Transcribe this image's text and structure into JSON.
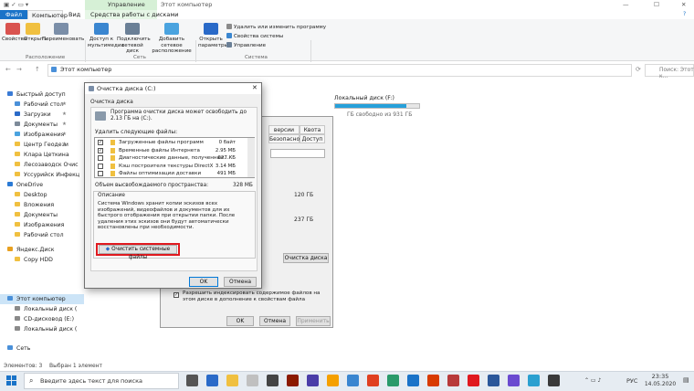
{
  "window": {
    "title": "Этот компьютер",
    "context_tab_title": "Управление",
    "minimize": "—",
    "maximize": "☐",
    "close": "✕"
  },
  "ribbon_tabs": {
    "file": "Файл",
    "computer": "Компьютер",
    "view": "Вид",
    "tools": "Средства работы с дисками"
  },
  "ribbon": {
    "properties": "Свойства",
    "open": "Открыть",
    "rename": "Переименовать",
    "media_access": "Доступ к мультимедиа",
    "map_drive": "Подключить сетевой диск",
    "add_location": "Добавить сетевое расположение",
    "open_settings": "Открыть параметры",
    "uninstall": "Удалить или изменить программу",
    "system_props": "Свойства системы",
    "manage": "Управление",
    "group_location": "Расположение",
    "group_network": "Сеть",
    "group_system": "Система"
  },
  "address": {
    "path": "Этот компьютер",
    "search_placeholder": "Поиск: Этот к...",
    "up_arrow": "↑",
    "back": "←",
    "forward": "→",
    "refresh": "⟳"
  },
  "nav": [
    {
      "label": "Быстрый доступ",
      "color": "#3a7bd5",
      "pin": ""
    },
    {
      "label": "Рабочий стол",
      "color": "#4a90d9",
      "pin": "★"
    },
    {
      "label": "Загрузки",
      "color": "#2a6ac8",
      "pin": "★"
    },
    {
      "label": "Документы",
      "color": "#7d8a99",
      "pin": "★"
    },
    {
      "label": "Изображения",
      "color": "#4aa3df",
      "pin": "★"
    },
    {
      "label": "Центр Геодези",
      "color": "#f0c040",
      "pin": "★"
    },
    {
      "label": "Клара Цеткина",
      "color": "#f0c040",
      "pin": ""
    },
    {
      "label": "Лесозаводск Очис",
      "color": "#f0c040",
      "pin": ""
    },
    {
      "label": "Уссурийск Инфекц",
      "color": "#f0c040",
      "pin": ""
    },
    {
      "label": "OneDrive",
      "color": "#2a7ad5",
      "pin": ""
    },
    {
      "label": "Desktop",
      "color": "#f0c040",
      "pin": ""
    },
    {
      "label": "Вложения",
      "color": "#f0c040",
      "pin": ""
    },
    {
      "label": "Документы",
      "color": "#f0c040",
      "pin": ""
    },
    {
      "label": "Изображения",
      "color": "#f0c040",
      "pin": ""
    },
    {
      "label": "Рабочий стол",
      "color": "#f0c040",
      "pin": ""
    },
    {
      "label": "Яндекс.Диск",
      "color": "#e8a020",
      "pin": ""
    },
    {
      "label": "Copy HDD",
      "color": "#f0c040",
      "pin": ""
    },
    {
      "label": "Этот компьютер",
      "color": "#4a90d9",
      "pin": ""
    },
    {
      "label": "Локальный диск (",
      "color": "#8a8a8a",
      "pin": ""
    },
    {
      "label": "CD-дисковод (E:)",
      "color": "#8a8a8a",
      "pin": ""
    },
    {
      "label": "Локальный диск (",
      "color": "#8a8a8a",
      "pin": ""
    },
    {
      "label": "Сеть",
      "color": "#4a90d9",
      "pin": ""
    }
  ],
  "drive_f": {
    "name": "Локальный диск (F:)",
    "free": "ГБ свободно из 931 ГБ",
    "fill": 0.85
  },
  "properties_dialog": {
    "tab_versions": "версии",
    "tab_quota": "Квота",
    "tab_access": "Доступ",
    "tab_security": "Безопасность",
    "v1": "120 ГБ",
    "v2": "237 ГБ",
    "cleanup_btn": "Очистка диска",
    "index_text": "Разрешить индексировать содержимое файлов на этом диске в дополнение к свойствам файла",
    "ok": "OK",
    "cancel": "Отмена",
    "apply": "Применить"
  },
  "cleanup": {
    "title": "Очистка диска  (C:)",
    "tab": "Очистка диска",
    "intro": "Программа очистки диска может освободить до 2.13 ГБ на (C:).",
    "files_label": "Удалить следующие файлы:",
    "items": [
      {
        "checked": true,
        "label": "Загруженные файлы программ",
        "size": "0 байт"
      },
      {
        "checked": true,
        "label": "Временные файлы Интернета",
        "size": "2.95 МБ"
      },
      {
        "checked": false,
        "label": "Диагностические данные, полученные…",
        "size": "627 КБ"
      },
      {
        "checked": false,
        "label": "Кэш построителя текстуры DirectX",
        "size": "3.14 МБ"
      },
      {
        "checked": false,
        "label": "Файлы оптимизации доставки",
        "size": "491 МБ"
      }
    ],
    "total_label": "Объем высвобождаемого пространства:",
    "total": "328 МБ",
    "desc_label": "Описание",
    "description": "Система Windows хранит копии эскизов всех изображений, видеофайлов и документов для их быстрого отображения при открытии папки. После удаления этих эскизов они будут автоматически восстановлены при необходимости.",
    "clean_system": "Очистить системные файлы",
    "ok": "OK",
    "cancel": "Отмена"
  },
  "status": {
    "count": "Элементов: 3",
    "selected": "Выбран 1 элемент"
  },
  "taskbar": {
    "search": "Введите здесь текст для поиска",
    "lang": "РУС",
    "time": "23:35",
    "date": "14.05.2020"
  }
}
